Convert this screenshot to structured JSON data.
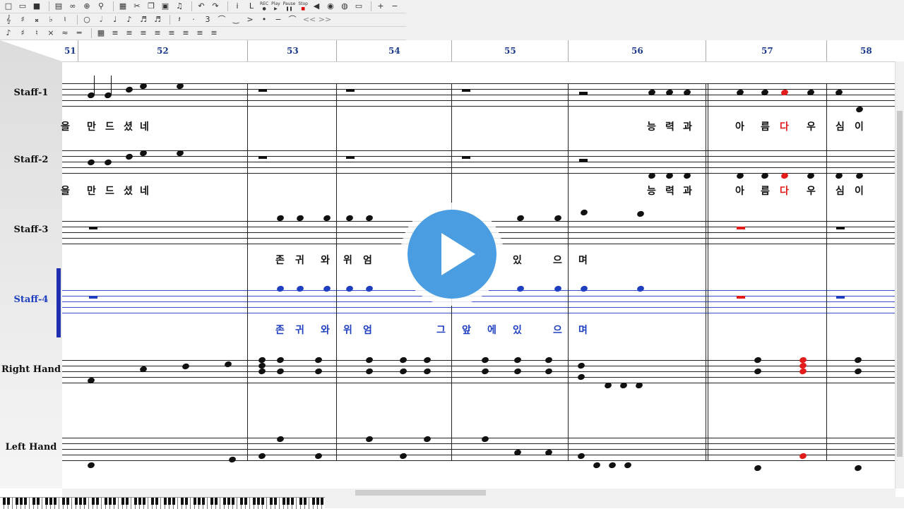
{
  "toolbar": {
    "row1_icons": [
      "new-file-icon",
      "open-folder-icon",
      "save-icon",
      "print-preview-icon",
      "glasses-icon",
      "zoom-icon",
      "search-icon",
      "print-icon",
      "cut-icon",
      "copy-icon",
      "paste-icon",
      "note-icon",
      "undo-icon",
      "redo-icon",
      "info-icon",
      "lyrics-icon",
      "record-icon",
      "play-icon",
      "pause-icon",
      "stop-icon",
      "speaker-icon",
      "record-audio-icon",
      "keyboard-icon",
      "plus-icon",
      "minus-icon"
    ],
    "transport": {
      "rec": "REC",
      "play": "Play",
      "pause": "Pause",
      "stop": "Stop"
    },
    "row2_icons": [
      "clef-icon",
      "sharp-icon",
      "double-sharp-icon",
      "flat-icon",
      "natural-icon",
      "whole-note-icon",
      "half-note-icon",
      "quarter-note-icon",
      "eighth-note-icon",
      "sixteenth-note-icon",
      "thirtysecond-note-icon",
      "rest-icon",
      "dot-icon",
      "triplet-icon",
      "tie-icon"
    ],
    "nav_arrows": "<< >>"
  },
  "ruler": {
    "measures": [
      "51",
      "52",
      "53",
      "54",
      "55",
      "56",
      "57",
      "58"
    ]
  },
  "staves": [
    {
      "label": "Staff-1",
      "lyrics_left": [
        "을",
        "만",
        "드",
        "셨",
        "네"
      ],
      "lyrics_right": [
        "능",
        "력",
        "과",
        "아",
        "름",
        "다",
        "우",
        "심",
        "이"
      ],
      "red_index": 5
    },
    {
      "label": "Staff-2",
      "lyrics_left": [
        "을",
        "만",
        "드",
        "셨",
        "네"
      ],
      "lyrics_right": [
        "능",
        "력",
        "과",
        "아",
        "름",
        "다",
        "우",
        "심",
        "이"
      ],
      "red_index": 5
    },
    {
      "label": "Staff-3",
      "lyrics": [
        "존",
        "귀",
        "와",
        "위",
        "엄",
        "있",
        "으",
        "며"
      ]
    },
    {
      "label": "Staff-4",
      "lyrics": [
        "존",
        "귀",
        "와",
        "위",
        "엄",
        "그",
        "앞",
        "에",
        "있",
        "으",
        "며"
      ]
    },
    {
      "label": "Right Hand"
    },
    {
      "label": "Left Hand"
    }
  ],
  "colors": {
    "selected": "#1f3ec0",
    "highlight": "#e21b1b",
    "measure_number": "#1a3a8a",
    "play_button": "#4a9de0"
  },
  "overlay": {
    "icon": "play-button-icon"
  }
}
